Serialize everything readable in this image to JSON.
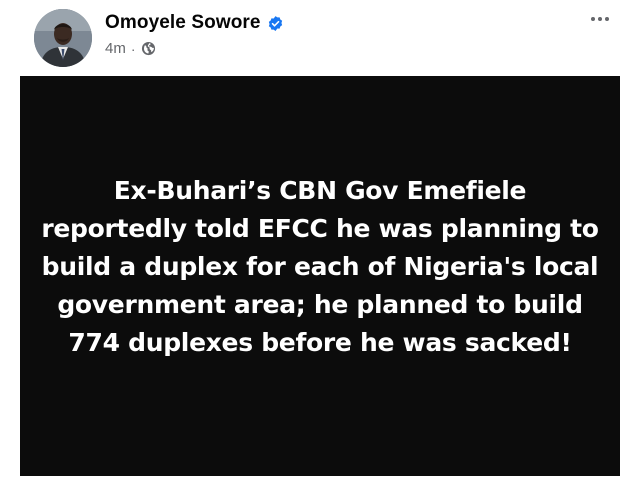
{
  "post": {
    "author": {
      "name": "Omoyele Sowore",
      "verified": true,
      "avatar": "profile-photo"
    },
    "meta": {
      "time": "4m",
      "separator": "·",
      "audience_icon": "globe-icon"
    },
    "more_icon": "more-horizontal-icon",
    "text_card": {
      "background": "#0c0c0c",
      "text_color": "#ffffff",
      "text": "Ex-Buhari’s CBN Gov Emefiele reportedly told EFCC he was planning to build a duplex for each of Nigeria's local government area; he planned to build 774 duplexes before he was sacked!"
    }
  },
  "colors": {
    "verified_badge": "#1877f2",
    "meta_text": "#65676b",
    "name_text": "#050505"
  }
}
